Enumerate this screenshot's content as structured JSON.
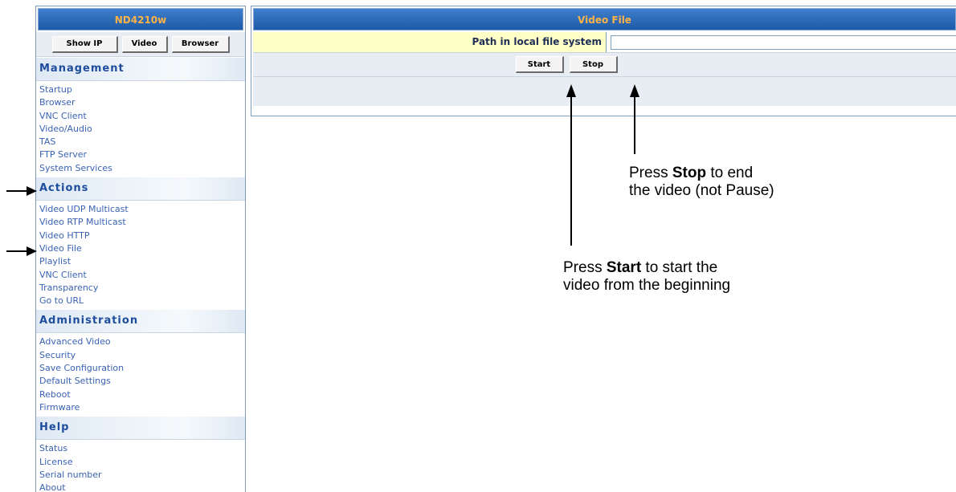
{
  "sidebar": {
    "title": "ND4210w",
    "buttons": [
      "Show IP",
      "Video",
      "Browser"
    ],
    "sections": [
      {
        "header": "Management",
        "items": [
          "Startup",
          "Browser",
          "VNC Client",
          "Video/Audio",
          "TAS",
          "FTP Server",
          "System Services"
        ]
      },
      {
        "header": "Actions",
        "items": [
          "Video UDP Multicast",
          "Video RTP Multicast",
          "Video HTTP",
          "Video File",
          "Playlist",
          "VNC Client",
          "Transparency",
          "Go to URL"
        ]
      },
      {
        "header": "Administration",
        "items": [
          "Advanced Video",
          "Security",
          "Save Configuration",
          "Default Settings",
          "Reboot",
          "Firmware"
        ]
      },
      {
        "header": "Help",
        "items": [
          "Status",
          "License",
          "Serial number",
          "About"
        ]
      }
    ]
  },
  "main": {
    "title": "Video File",
    "path_label": "Path in local file system",
    "path_value": "",
    "start_label": "Start",
    "stop_label": "Stop"
  },
  "annotations": {
    "stop": {
      "prefix": "Press ",
      "bold": "Stop",
      "line1_suffix": " to end",
      "line2": "the video (not Pause)"
    },
    "start": {
      "prefix": "Press ",
      "bold": "Start",
      "line1_suffix": " to start the",
      "line2": "video from the beginning"
    }
  },
  "colors": {
    "title_bar": "#1d5aa8",
    "title_text": "#ffb347",
    "section_text": "#1f4d9e",
    "link_text": "#3a62b4",
    "label_bg": "#ffffc8",
    "panel_bg": "#e7edf3"
  }
}
